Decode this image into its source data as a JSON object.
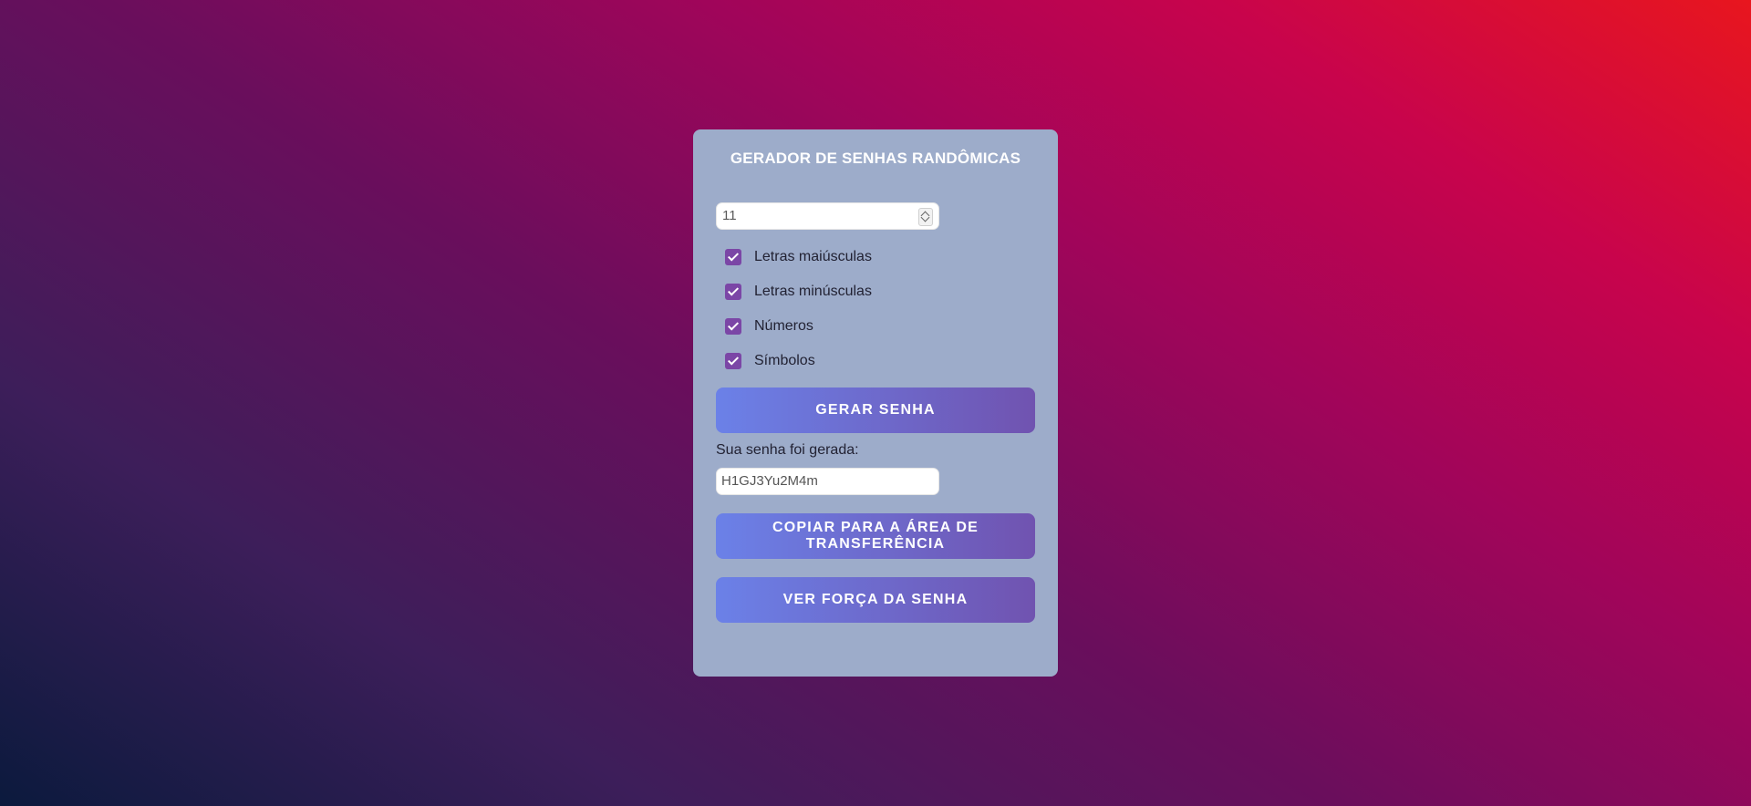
{
  "app": {
    "title": "GERADOR DE SENHAS RANDÔMICAS"
  },
  "length": {
    "value": "11"
  },
  "options": [
    {
      "label": "Letras maiúsculas",
      "checked": true
    },
    {
      "label": "Letras minúsculas",
      "checked": true
    },
    {
      "label": "Números",
      "checked": true
    },
    {
      "label": "Símbolos",
      "checked": true
    }
  ],
  "buttons": {
    "generate": "GERAR SENHA",
    "copy": "COPIAR PARA A ÁREA DE TRANSFERÊNCIA",
    "strength": "VER FORÇA DA SENHA"
  },
  "result": {
    "label": "Sua senha foi gerada:",
    "password": "H1GJ3Yu2M4m"
  },
  "colors": {
    "card": "#9dacca",
    "checkbox": "#7b46a6",
    "button_start": "#6b81e8",
    "button_end": "#7053b0"
  }
}
